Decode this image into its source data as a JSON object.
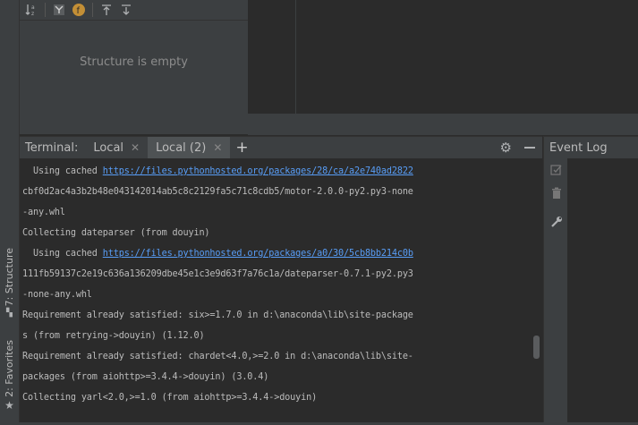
{
  "structure": {
    "empty_text": "Structure is empty",
    "toolbar_icons": [
      "sort-alpha-icon",
      "filter-icon",
      "field-f-icon",
      "expand-all-icon",
      "collapse-all-icon"
    ]
  },
  "left_strip": {
    "tabs": [
      {
        "label": "7: Structure",
        "icon": "structure-icon"
      },
      {
        "label": "2: Favorites",
        "icon": "star-icon"
      }
    ]
  },
  "terminal": {
    "title": "Terminal:",
    "tabs": [
      {
        "label": "Local",
        "active": false
      },
      {
        "label": "Local (2)",
        "active": true
      }
    ],
    "add_label": "+",
    "lines": [
      {
        "prefix": "  Using cached ",
        "link": "https://files.pythonhosted.org/packages/28/ca/a2e740ad2822"
      },
      {
        "text": "cbf0d2ac4a3b2b48e043142014ab5c8c2129fa5c71c8cdb5/motor-2.0.0-py2.py3-none"
      },
      {
        "text": "-any.whl"
      },
      {
        "text": "Collecting dateparser (from douyin)"
      },
      {
        "prefix": "  Using cached ",
        "link": "https://files.pythonhosted.org/packages/a0/30/5cb8bb214c0b"
      },
      {
        "text": "111fb59137c2e19c636a136209dbe45e1c3e9d63f7a76c1a/dateparser-0.7.1-py2.py3"
      },
      {
        "text": "-none-any.whl"
      },
      {
        "text": "Requirement already satisfied: six>=1.7.0 in d:\\anaconda\\lib\\site-package"
      },
      {
        "text": "s (from retrying->douyin) (1.12.0)"
      },
      {
        "text": "Requirement already satisfied: chardet<4.0,>=2.0 in d:\\anaconda\\lib\\site-"
      },
      {
        "text": "packages (from aiohttp>=3.4.4->douyin) (3.0.4)"
      },
      {
        "text": "Collecting yarl<2.0,>=1.0 (from aiohttp>=3.4.4->douyin)"
      }
    ]
  },
  "event_log": {
    "title": "Event Log"
  },
  "colors": {
    "panel": "#3c3f41",
    "editor": "#2b2b2b",
    "link": "#589df6",
    "text": "#bbbbbb"
  }
}
